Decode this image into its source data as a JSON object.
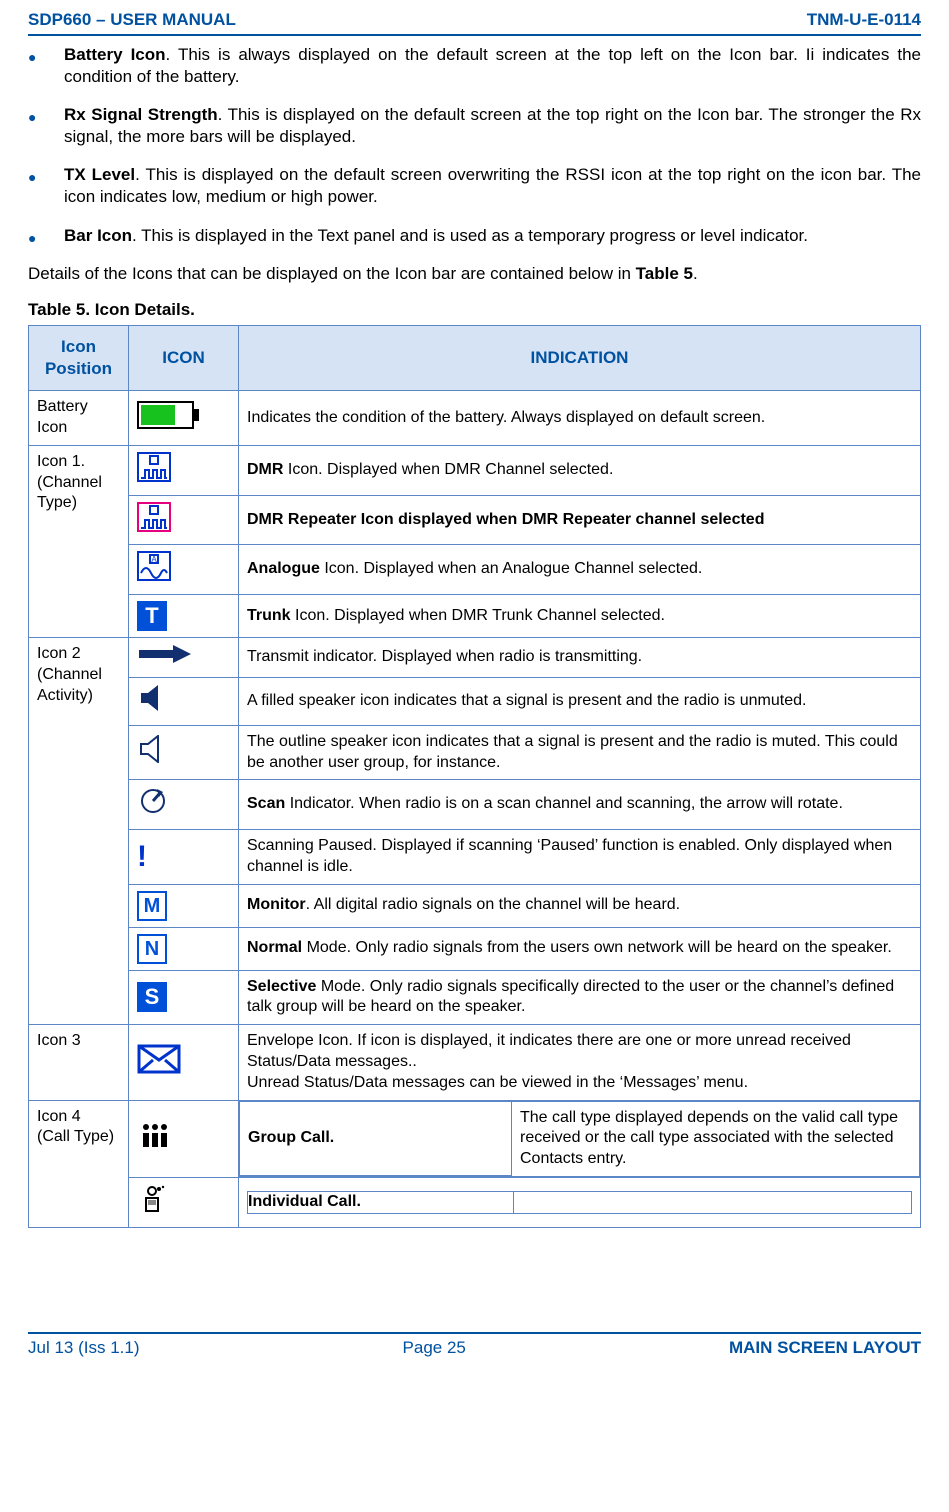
{
  "header": {
    "left": "SDP660 – USER MANUAL",
    "right": "TNM-U-E-0114"
  },
  "bullets": [
    {
      "title": "Battery Icon",
      "after_title": ".  This is always displayed on the default screen at the top left on the Icon bar.  Ii indicates the condition of the battery."
    },
    {
      "title": "Rx Signal Strength",
      "after_title": ".  This is  displayed on the default screen at the top right on the Icon bar.  The stronger the Rx signal, the more bars will be displayed."
    },
    {
      "title": "TX Level",
      "after_title": ". This is displayed on the default screen overwriting the RSSI icon at the top right on the icon bar.  The icon indicates low, medium or high power."
    },
    {
      "title": "Bar Icon",
      "after_title": ".  This is displayed in the Text panel and is used as a temporary progress or level indicator."
    }
  ],
  "details_line_pre": "Details of the Icons that can be displayed on the Icon bar are contained below in ",
  "details_line_bold": "Table 5",
  "details_line_post": ".",
  "table_caption": "Table 5.  Icon Details.",
  "th": {
    "pos": "Icon Position",
    "icon": "ICON",
    "ind": "INDICATION"
  },
  "rows": {
    "battery": {
      "pos": "Battery Icon",
      "ind": "Indicates the condition of the battery.  Always displayed on default screen."
    },
    "icon1": {
      "pos": "Icon 1.\n(Channel Type)",
      "dmr": {
        "bold": "DMR",
        "rest": " Icon.  Displayed when DMR  Channel selected."
      },
      "dmr_rep": "DMR Repeater Icon displayed when DMR Repeater channel selected",
      "analogue": {
        "bold": "Analogue",
        "rest": " Icon.  Displayed when an Analogue Channel selected."
      },
      "trunk": {
        "bold": "Trunk",
        "rest": " Icon.  Displayed when DMR Trunk Channel selected."
      }
    },
    "icon2": {
      "pos": "Icon 2\n(Channel Activity)",
      "tx": "Transmit indicator.  Displayed when radio is transmitting.",
      "spk_on": "A filled speaker icon indicates that a signal is present and the radio is unmuted.",
      "spk_off": "The outline speaker icon indicates that a signal is present and the radio is muted.  This could be another user group, for instance.",
      "scan": {
        "bold": "Scan",
        "rest": " Indicator.  When radio is on a scan channel and scanning, the arrow will rotate."
      },
      "paused": "Scanning Paused.  Displayed if scanning ‘Paused’ function is enabled.  Only displayed when channel is idle.",
      "monitor": {
        "bold": "Monitor",
        "rest": ".  All digital radio signals on the channel will be heard."
      },
      "normal": {
        "bold": "Normal",
        "rest": " Mode.  Only radio signals from the users own network will be heard on the speaker."
      },
      "selective": {
        "bold": "Selective",
        "rest": " Mode.  Only radio signals specifically directed to the user or the channel’s defined talk group will be heard on the speaker."
      }
    },
    "icon3": {
      "pos": "Icon 3",
      "text": "Envelope Icon.  If icon is displayed, it indicates there are one or more unread received Status/Data messages..\nUnread Status/Data messages can be viewed in the ‘Messages’ menu."
    },
    "icon4": {
      "pos": "Icon 4\n(Call Type)",
      "group": "Group Call.",
      "indiv": "Individual Call.",
      "note": "The call type displayed depends on the valid call type received or the call type associated with the selected Contacts entry."
    }
  },
  "footer": {
    "left": "Jul 13 (Iss 1.1)",
    "center": "Page 25",
    "right": "MAIN SCREEN LAYOUT"
  }
}
